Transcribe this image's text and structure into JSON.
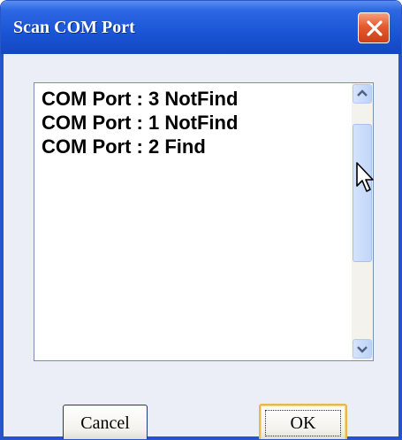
{
  "window": {
    "title": "Scan COM Port"
  },
  "list": {
    "items": [
      "COM Port : 3 NotFind",
      "COM Port : 1 NotFind",
      "COM Port : 2 Find"
    ]
  },
  "buttons": {
    "cancel": "Cancel",
    "ok": "OK"
  },
  "icons": {
    "close": "close-icon",
    "scroll_up": "chevron-up-icon",
    "scroll_down": "chevron-down-icon",
    "cursor": "mouse-pointer-icon"
  },
  "colors": {
    "titlebar": "#1a55d6",
    "close_button": "#e55a2f",
    "ok_button_border": "#e7b84d"
  }
}
